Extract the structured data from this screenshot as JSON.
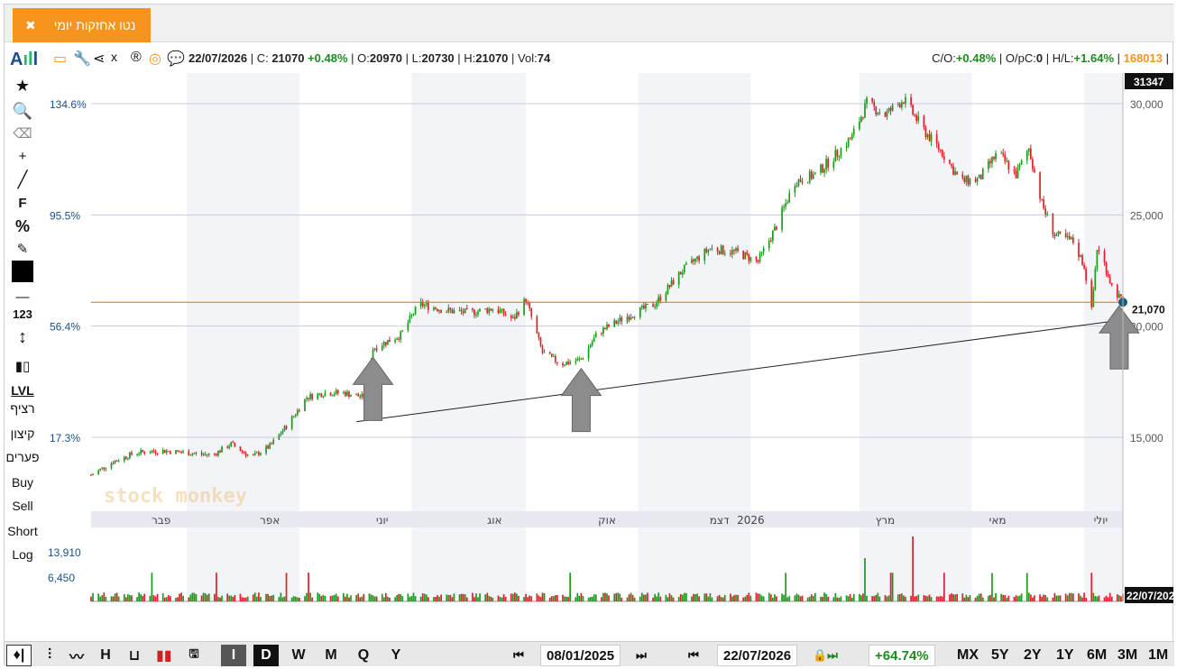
{
  "tab": {
    "title": "נטו אחזקות יומי",
    "close": "✖"
  },
  "toolbar_icons": [
    "logo-icon",
    "window-icon",
    "wrench-icon",
    "share-icon",
    "excel-icon",
    "registered-icon",
    "target-icon",
    "comment-icon"
  ],
  "info": {
    "date": "22/07/2026",
    "close_label": "C:",
    "close": "21070",
    "change": "+0.48%",
    "open_label": "O:",
    "open": "20970",
    "low_label": "L:",
    "low": "20730",
    "high_label": "H:",
    "high": "21070",
    "vol_label": "Vol:",
    "vol": "74"
  },
  "stats": {
    "co_label": "C/O:",
    "co": "+0.48%",
    "opc_label": "O/pC:",
    "opc": "0",
    "hl_label": "H/L:",
    "hl": "+1.64%",
    "id": "168013"
  },
  "left_tools": {
    "f": "F",
    "pct": "%",
    "n123": "123",
    "lvl": "LVL",
    "continuous": "רציף",
    "extreme": "קיצון",
    "gaps": "פערים",
    "buy": "Buy",
    "sell": "Sell",
    "short": "Short",
    "log": "Log"
  },
  "chart_data": {
    "type": "candlestick",
    "price_axis": {
      "ticks": [
        15000,
        20000,
        25000,
        30000
      ],
      "tick_labels": [
        "15,000",
        "20,000",
        "25,000",
        "30,000"
      ],
      "range": [
        12500,
        31347
      ],
      "top_label": "31347"
    },
    "pct_axis": {
      "tick_labels": [
        "17.3%",
        "56.4%",
        "95.5%",
        "134.6%"
      ]
    },
    "last_price_label": "21,070",
    "last_price": 21070,
    "months": [
      "פבר",
      "אפר",
      "יוני",
      "אוג",
      "אוק",
      "דצמ",
      "2026",
      "מרץ",
      "מאי",
      "יולי"
    ],
    "volume_axis": {
      "tick_labels": [
        "13,910",
        "6,450"
      ]
    },
    "volume_date_label": "22/07/2026",
    "watermark": "stock monkey",
    "price_path": [
      [
        "2025-01-08",
        13300
      ],
      [
        "2025-01-20",
        13900
      ],
      [
        "2025-02-01",
        14300
      ],
      [
        "2025-02-15",
        14400
      ],
      [
        "2025-03-01",
        14300
      ],
      [
        "2025-03-15",
        14200
      ],
      [
        "2025-03-25",
        14700
      ],
      [
        "2025-04-05",
        14100
      ],
      [
        "2025-04-15",
        14600
      ],
      [
        "2025-04-25",
        15600
      ],
      [
        "2025-05-05",
        16800
      ],
      [
        "2025-05-15",
        17000
      ],
      [
        "2025-05-25",
        17000
      ],
      [
        "2025-06-05",
        16800
      ],
      [
        "2025-06-10",
        19000
      ],
      [
        "2025-06-25",
        19600
      ],
      [
        "2025-07-05",
        21000
      ],
      [
        "2025-07-20",
        20700
      ],
      [
        "2025-08-01",
        20600
      ],
      [
        "2025-08-15",
        20800
      ],
      [
        "2025-08-25",
        20300
      ],
      [
        "2025-09-01",
        21200
      ],
      [
        "2025-09-10",
        18800
      ],
      [
        "2025-09-20",
        18300
      ],
      [
        "2025-10-01",
        18500
      ],
      [
        "2025-10-10",
        19700
      ],
      [
        "2025-10-25",
        20400
      ],
      [
        "2025-11-10",
        21000
      ],
      [
        "2025-11-25",
        22500
      ],
      [
        "2025-12-10",
        23500
      ],
      [
        "2025-12-25",
        23300
      ],
      [
        "2026-01-05",
        22900
      ],
      [
        "2026-01-15",
        24500
      ],
      [
        "2026-01-25",
        26500
      ],
      [
        "2026-02-05",
        26800
      ],
      [
        "2026-02-15",
        27600
      ],
      [
        "2026-02-25",
        28500
      ],
      [
        "2026-03-05",
        30000
      ],
      [
        "2026-03-15",
        29500
      ],
      [
        "2026-03-25",
        30200
      ],
      [
        "2026-04-05",
        28800
      ],
      [
        "2026-04-15",
        27800
      ],
      [
        "2026-04-25",
        26500
      ],
      [
        "2026-05-05",
        26600
      ],
      [
        "2026-05-15",
        27800
      ],
      [
        "2026-05-25",
        26800
      ],
      [
        "2026-06-01",
        28000
      ],
      [
        "2026-06-08",
        25500
      ],
      [
        "2026-06-15",
        24100
      ],
      [
        "2026-06-25",
        23800
      ],
      [
        "2026-07-01",
        22700
      ],
      [
        "2026-07-05",
        20700
      ],
      [
        "2026-07-08",
        23500
      ],
      [
        "2026-07-12",
        22800
      ],
      [
        "2026-07-16",
        21800
      ],
      [
        "2026-07-22",
        21070
      ]
    ],
    "trendline": [
      [
        "2025-06-01",
        15700
      ],
      [
        "2026-07-22",
        20280
      ]
    ],
    "horizontal_line": 21070,
    "arrows_at": [
      "2025-06-10",
      "2025-10-01",
      "2026-07-20"
    ]
  },
  "colors": {
    "up": "#1e9a1e",
    "down": "#e0202a",
    "hline": "#e07000",
    "arrow": "#8c8c8c",
    "accent": "#f7941d"
  },
  "bottom": {
    "buttons": [
      "I",
      "D",
      "W",
      "M",
      "Q",
      "Y"
    ],
    "from_date": "08/01/2025",
    "to_date": "22/07/2026",
    "change_pct": "+64.74%",
    "ranges": [
      "MX",
      "5Y",
      "2Y",
      "1Y",
      "6M",
      "3M",
      "1M"
    ],
    "chart_type_icons": [
      "candles-icon",
      "ohlc-icon",
      "line-icon",
      "h-icon",
      "u-icon",
      "color-bars-icon",
      "save-icon"
    ]
  }
}
